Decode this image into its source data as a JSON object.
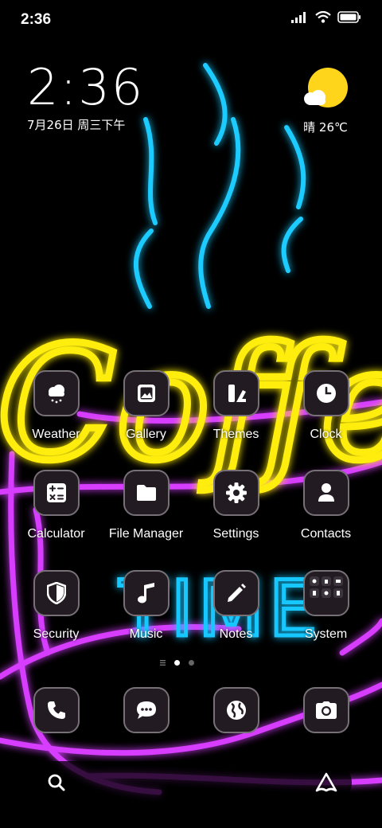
{
  "status_bar": {
    "time": "2:36",
    "icons": [
      "signal-icon",
      "wifi-icon",
      "battery-icon"
    ]
  },
  "clock_widget": {
    "time": "2:36",
    "date": "7月26日 周三下午"
  },
  "weather_widget": {
    "icon": "sun-cloud-icon",
    "text": "晴 26℃"
  },
  "wallpaper": {
    "words": [
      "Coffee",
      "TIME"
    ],
    "colors": {
      "steam": "#1ecbff",
      "coffee": "#ffee10",
      "cup": "#d63cff",
      "time": "#18c8ff"
    }
  },
  "apps": [
    {
      "id": "weather",
      "label": "Weather",
      "icon": "cloud-rain-icon"
    },
    {
      "id": "gallery",
      "label": "Gallery",
      "icon": "image-icon"
    },
    {
      "id": "themes",
      "label": "Themes",
      "icon": "brush-icon"
    },
    {
      "id": "clock",
      "label": "Clock",
      "icon": "clock-icon"
    },
    {
      "id": "calculator",
      "label": "Calculator",
      "icon": "calculator-icon"
    },
    {
      "id": "file-manager",
      "label": "File Manager",
      "icon": "folder-icon"
    },
    {
      "id": "settings",
      "label": "Settings",
      "icon": "gear-icon"
    },
    {
      "id": "contacts",
      "label": "Contacts",
      "icon": "person-icon"
    },
    {
      "id": "security",
      "label": "Security",
      "icon": "shield-icon"
    },
    {
      "id": "music",
      "label": "Music",
      "icon": "music-note-icon"
    },
    {
      "id": "notes",
      "label": "Notes",
      "icon": "pencil-icon"
    },
    {
      "id": "system",
      "label": "System",
      "icon": "folder-grid-icon"
    }
  ],
  "page_indicator": {
    "pages": 2,
    "current": 1
  },
  "dock": [
    {
      "id": "phone",
      "icon": "phone-icon"
    },
    {
      "id": "messages",
      "icon": "chat-icon"
    },
    {
      "id": "browser",
      "icon": "globe-icon"
    },
    {
      "id": "camera",
      "icon": "camera-icon"
    }
  ],
  "search_bar": {
    "left_icon": "search-icon",
    "right_icon": "assistant-icon"
  }
}
